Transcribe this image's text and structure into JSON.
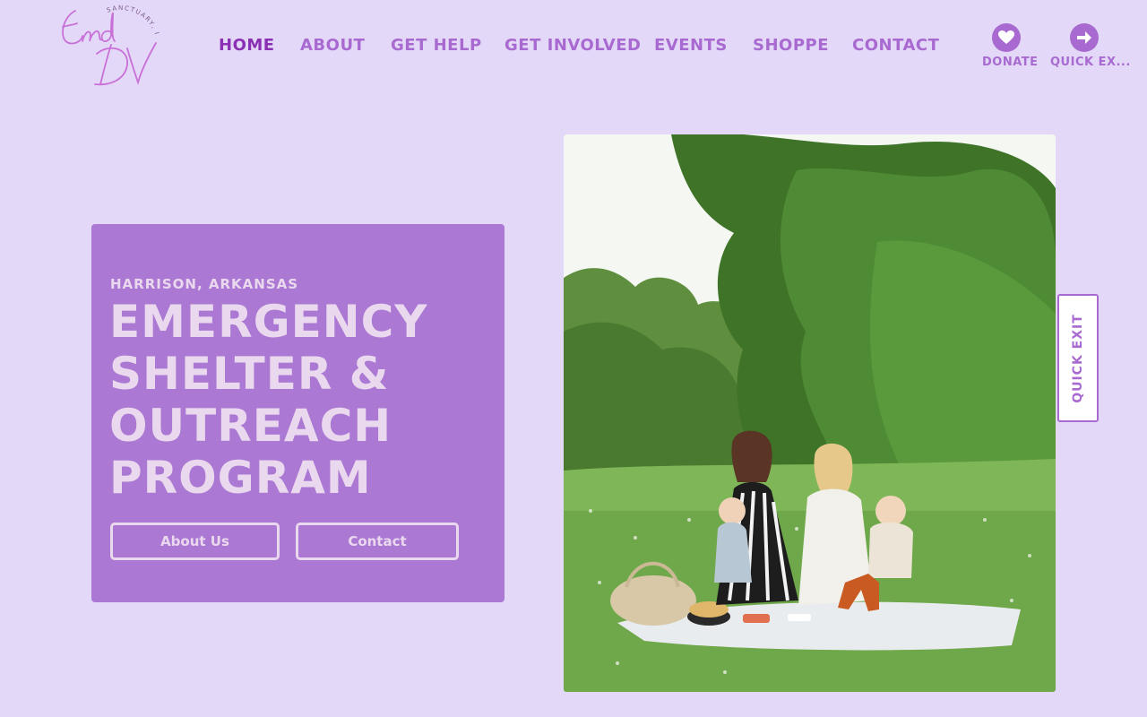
{
  "brand": {
    "logo_script": "End DV",
    "logo_arc": "SANCTUARY, INC.",
    "logo_color": "#c870d8"
  },
  "nav": {
    "items": [
      {
        "label": "HOME",
        "active": true
      },
      {
        "label": "ABOUT"
      },
      {
        "label": "GET HELP"
      },
      {
        "label": "GET INVOLVED"
      },
      {
        "label": "EVENTS"
      },
      {
        "label": "SHOPPE"
      },
      {
        "label": "CONTACT"
      }
    ]
  },
  "header_actions": {
    "donate": {
      "label": "DONATE",
      "icon": "heart-icon"
    },
    "quick_exit": {
      "label": "QUICK EX...",
      "icon": "arrow-right-icon"
    }
  },
  "hero": {
    "eyebrow": "HARRISON, ARKANSAS",
    "title": "EMERGENCY SHELTER & OUTREACH PROGRAM",
    "buttons": {
      "about": "About Us",
      "contact": "Contact"
    }
  },
  "side_tab": {
    "label": "QUICK EXIT"
  },
  "colors": {
    "page_bg": "#e4d8f8",
    "accent": "#a86ad0",
    "accent_dark": "#8a30b4",
    "card_bg": "#ab78d3",
    "card_text": "#ead9ee"
  }
}
